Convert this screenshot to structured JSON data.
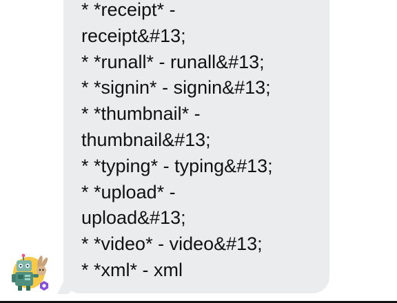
{
  "message": {
    "lines": [
      "* *receipt* -",
      "receipt&#13;",
      "* *runall* - runall&#13;",
      "* *signin* - signin&#13;",
      "* *thumbnail* -",
      "thumbnail&#13;",
      "* *typing* - typing&#13;",
      "* *upload* -",
      "upload&#13;",
      "* *video* - video&#13;",
      "* *xml* - xml"
    ]
  },
  "colors": {
    "bubble": "#ebecee",
    "text": "#111111",
    "background": "#ffffff"
  },
  "icons": {
    "avatar": "bot-avatar-icon"
  }
}
